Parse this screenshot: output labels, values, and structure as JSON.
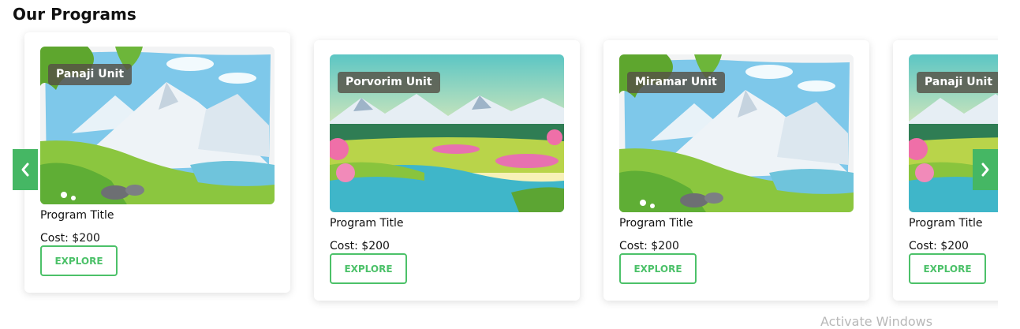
{
  "section": {
    "title": "Our Programs"
  },
  "cards": [
    {
      "unit": "Panaji Unit",
      "title": "Program Title",
      "cost": "Cost: $200",
      "button": "EXPLORE",
      "scene": "snow-mountain"
    },
    {
      "unit": "Porvorim Unit",
      "title": "Program Title",
      "cost": "Cost: $200",
      "button": "EXPLORE",
      "scene": "river-valley"
    },
    {
      "unit": "Miramar Unit",
      "title": "Program Title",
      "cost": "Cost: $200",
      "button": "EXPLORE",
      "scene": "snow-mountain"
    },
    {
      "unit": "Panaji Unit",
      "title": "Program Title",
      "cost": "Cost: $200",
      "button": "EXPLORE",
      "scene": "river-valley"
    }
  ],
  "carousel": {
    "prev_icon": "chevron-left-icon",
    "next_icon": "chevron-right-icon"
  },
  "os_watermark": "Activate Windows",
  "colors": {
    "accent": "#4cc169",
    "arrow_bg": "#45b764",
    "badge_bg": "#555046"
  }
}
